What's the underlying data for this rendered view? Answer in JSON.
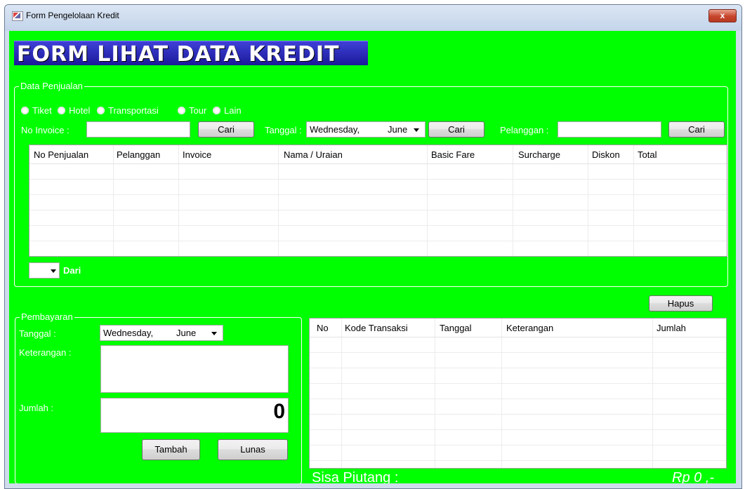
{
  "window": {
    "title": "Form Pengelolaan Kredit",
    "close_glyph": "x"
  },
  "banner": {
    "text": "FORM LIHAT DATA KREDIT"
  },
  "penjualan": {
    "legend": "Data Penjualan",
    "radios": [
      "Tiket",
      "Hotel",
      "Transportasi",
      "Tour",
      "Lain"
    ],
    "no_invoice_label": "No Invoice :",
    "cari_label": "Cari",
    "tanggal_label": "Tanggal :",
    "date_day": "Wednesday,",
    "date_month": "June",
    "pelanggan_label": "Pelanggan :",
    "columns": [
      "No Penjualan",
      "Pelanggan",
      "Invoice",
      "Nama / Uraian",
      "Basic Fare",
      "Surcharge",
      "Diskon",
      "Total"
    ],
    "dari_label": "Dari"
  },
  "hapus_label": "Hapus",
  "pembayaran": {
    "legend": "Pembayaran",
    "tanggal_label": "Tanggal :",
    "date_day": "Wednesday,",
    "date_month": "June",
    "keterangan_label": "Keterangan :",
    "jumlah_label": "Jumlah :",
    "jumlah_value": "0",
    "tambah_label": "Tambah",
    "lunas_label": "Lunas"
  },
  "transaksi": {
    "columns": [
      "No",
      "Kode Transaksi",
      "Tanggal",
      "Keterangan",
      "Jumlah"
    ]
  },
  "footer": {
    "sisa_label": "Sisa Piutang :",
    "sisa_value": "Rp 0 ,-"
  },
  "colors": {
    "background": "#00ff00",
    "banner": "#2a2ab8"
  }
}
